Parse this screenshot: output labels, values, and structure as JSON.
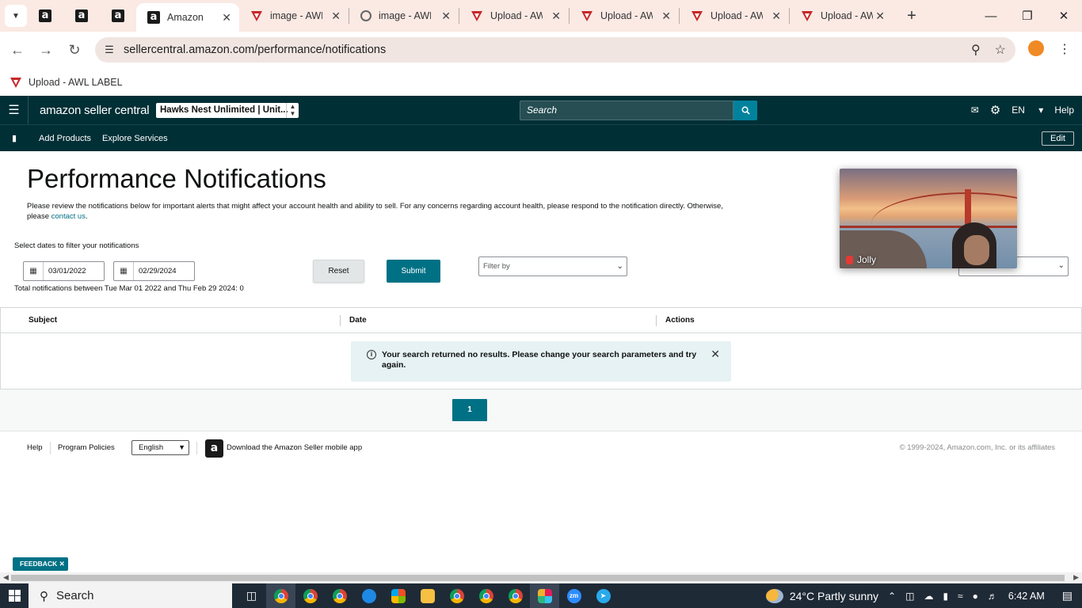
{
  "browser": {
    "tabs": [
      {
        "title": "Amazon",
        "active": true
      },
      {
        "title": "image - AWL",
        "active": false
      },
      {
        "title": "image - AWL",
        "active": false
      },
      {
        "title": "Upload - AWL",
        "active": false
      },
      {
        "title": "Upload - AWL",
        "active": false
      },
      {
        "title": "Upload - AWL",
        "active": false
      },
      {
        "title": "Upload - AWL",
        "active": false
      }
    ],
    "url": "sellercentral.amazon.com/performance/notifications",
    "bookmark": "Upload - AWL LABEL"
  },
  "header": {
    "logo_text": "amazon seller central",
    "store": "Hawks Nest Unlimited | Unit...",
    "search_placeholder": "Search",
    "language": "EN",
    "help": "Help"
  },
  "nav": {
    "links": [
      "Add Products",
      "Explore Services"
    ],
    "edit": "Edit"
  },
  "page": {
    "title": "Performance Notifications",
    "description": "Please review the notifications below for important alerts that might affect your account health and ability to sell. For any concerns regarding account health, please respond to the notification directly. Otherwise, please",
    "contact_link": "contact us",
    "filter_label": "Select dates to filter your notifications",
    "start_date": "03/01/2022",
    "end_date": "02/29/2024",
    "reset": "Reset",
    "submit": "Submit",
    "filter_placeholder": "Filter by",
    "total": "Total notifications between Tue Mar 01 2022 and Thu Feb 29 2024: 0"
  },
  "table": {
    "columns": [
      "Subject",
      "Date",
      "Actions"
    ],
    "no_results": "Your search returned no results. Please change your search parameters and try again."
  },
  "pagination": {
    "current": "1"
  },
  "video": {
    "participant": "Jolly"
  },
  "footer": {
    "help": "Help",
    "policies": "Program Policies",
    "language": "English",
    "app": "Download the Amazon Seller mobile app",
    "copyright": "© 1999-2024, Amazon.com, Inc. or its affiliates"
  },
  "feedback": "FEEDBACK",
  "taskbar": {
    "search": "Search",
    "weather": "24°C  Partly sunny",
    "time": "6:42 AM"
  },
  "colors": {
    "header_bg": "#002f36",
    "primary_button": "#007185",
    "search_button": "#00829c",
    "tab_strip": "#fbe9e4"
  }
}
